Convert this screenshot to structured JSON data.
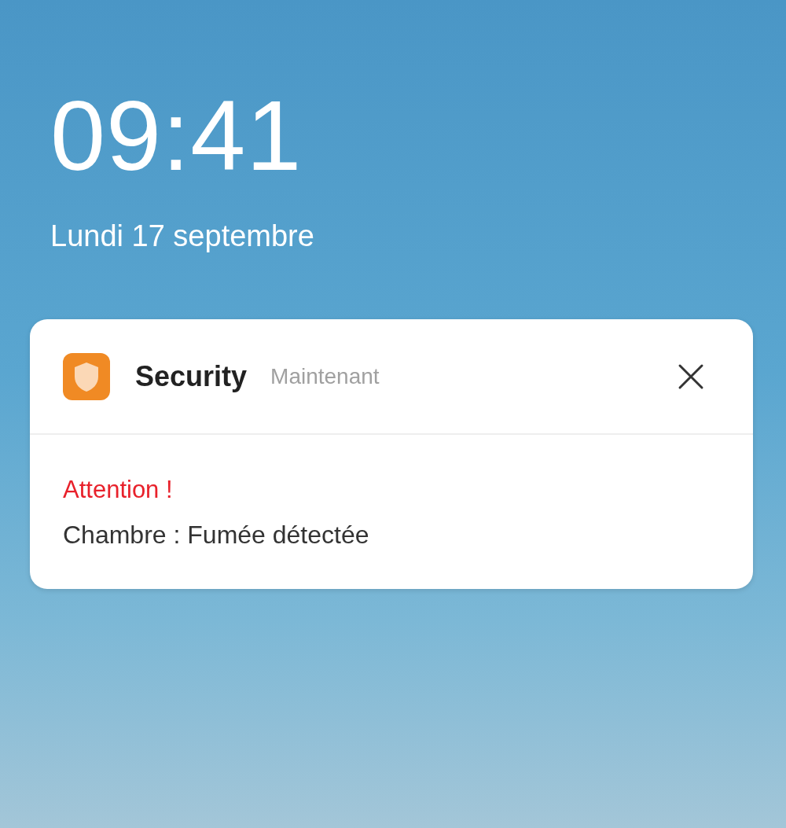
{
  "lock_screen": {
    "time": "09:41",
    "date": "Lundi 17 septembre"
  },
  "notification": {
    "app_name": "Security",
    "timestamp": "Maintenant",
    "title": "Attention !",
    "message": "Chambre : Fumée détectée"
  }
}
